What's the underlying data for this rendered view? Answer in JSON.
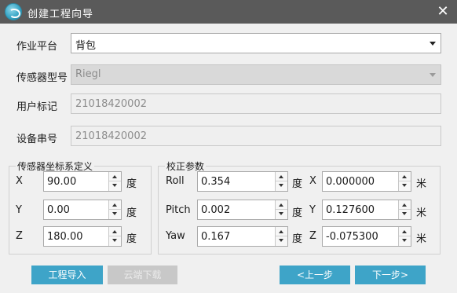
{
  "window": {
    "title": "创建工程向导",
    "icon": "app-logo-icon",
    "close_icon": "close-icon",
    "close_glyph": "✕"
  },
  "fields": {
    "platform_label": "作业平台",
    "platform_value": "背包",
    "sensor_model_label": "传感器型号",
    "sensor_model_value": "Riegl",
    "user_tag_label": "用户标记",
    "user_tag_value": "21018420002",
    "device_serial_label": "设备串号",
    "device_serial_value": "21018420002"
  },
  "sensor_coords": {
    "title": "传感器坐标系定义",
    "rows": [
      {
        "label": "X",
        "value": "90.00",
        "unit": "度"
      },
      {
        "label": "Y",
        "value": "0.00",
        "unit": "度"
      },
      {
        "label": "Z",
        "value": "180.00",
        "unit": "度"
      }
    ]
  },
  "calibration": {
    "title": "校正参数",
    "rows": [
      {
        "angle_label": "Roll",
        "angle_value": "0.354",
        "angle_unit": "度",
        "axis_label": "X",
        "axis_value": "0.000000",
        "axis_unit": "米"
      },
      {
        "angle_label": "Pitch",
        "angle_value": "0.002",
        "angle_unit": "度",
        "axis_label": "Y",
        "axis_value": "0.127600",
        "axis_unit": "米"
      },
      {
        "angle_label": "Yaw",
        "angle_value": "0.167",
        "angle_unit": "度",
        "axis_label": "Z",
        "axis_value": "-0.075300",
        "axis_unit": "米"
      }
    ]
  },
  "buttons": {
    "import": "工程导入",
    "cloud_download": "云端下载",
    "prev": "<上一步",
    "next": "下一步>"
  },
  "colors": {
    "titlebar": "#5a5a5a",
    "accent": "#3ea4c8",
    "disabled": "#c8c8c8"
  }
}
